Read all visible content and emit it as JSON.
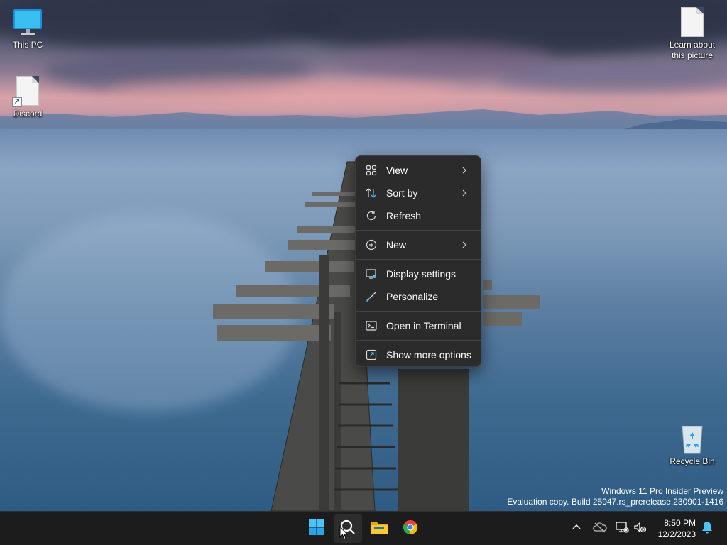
{
  "desktop": {
    "icons": [
      {
        "label": "This PC",
        "icon": "monitor-icon"
      },
      {
        "label": "Discord",
        "icon": "file-shortcut-icon"
      },
      {
        "label_line1": "Learn about",
        "label_line2": "this picture",
        "icon": "file-icon"
      },
      {
        "label": "Recycle Bin",
        "icon": "recycle-bin-icon"
      }
    ]
  },
  "context_menu": {
    "items": [
      {
        "label": "View",
        "icon": "grid-icon",
        "submenu": true
      },
      {
        "label": "Sort by",
        "icon": "sort-arrows-icon",
        "submenu": true
      },
      {
        "label": "Refresh",
        "icon": "refresh-icon",
        "submenu": false
      },
      {
        "label": "New",
        "icon": "plus-circle-icon",
        "submenu": true
      },
      {
        "label": "Display settings",
        "icon": "display-icon",
        "submenu": false
      },
      {
        "label": "Personalize",
        "icon": "brush-icon",
        "submenu": false
      },
      {
        "label": "Open in Terminal",
        "icon": "terminal-icon",
        "submenu": false
      },
      {
        "label": "Show more options",
        "icon": "expand-icon",
        "submenu": false
      }
    ]
  },
  "watermark": {
    "line1": "Windows 11 Pro Insider Preview",
    "line2": "Evaluation copy. Build 25947.rs_prerelease.230901-1416"
  },
  "taskbar": {
    "apps": [
      "start-icon",
      "search-icon",
      "file-explorer-icon",
      "chrome-icon"
    ],
    "tray": [
      "chevron-up-icon",
      "onedrive-icon",
      "network-icon",
      "volume-muted-icon"
    ],
    "time": "8:50 PM",
    "date": "12/2/2023",
    "notification": "bell-icon"
  },
  "colors": {
    "menu_bg": "#2b2b2b",
    "taskbar_bg": "#1c1c1c",
    "accent": "#4cc2ff"
  }
}
